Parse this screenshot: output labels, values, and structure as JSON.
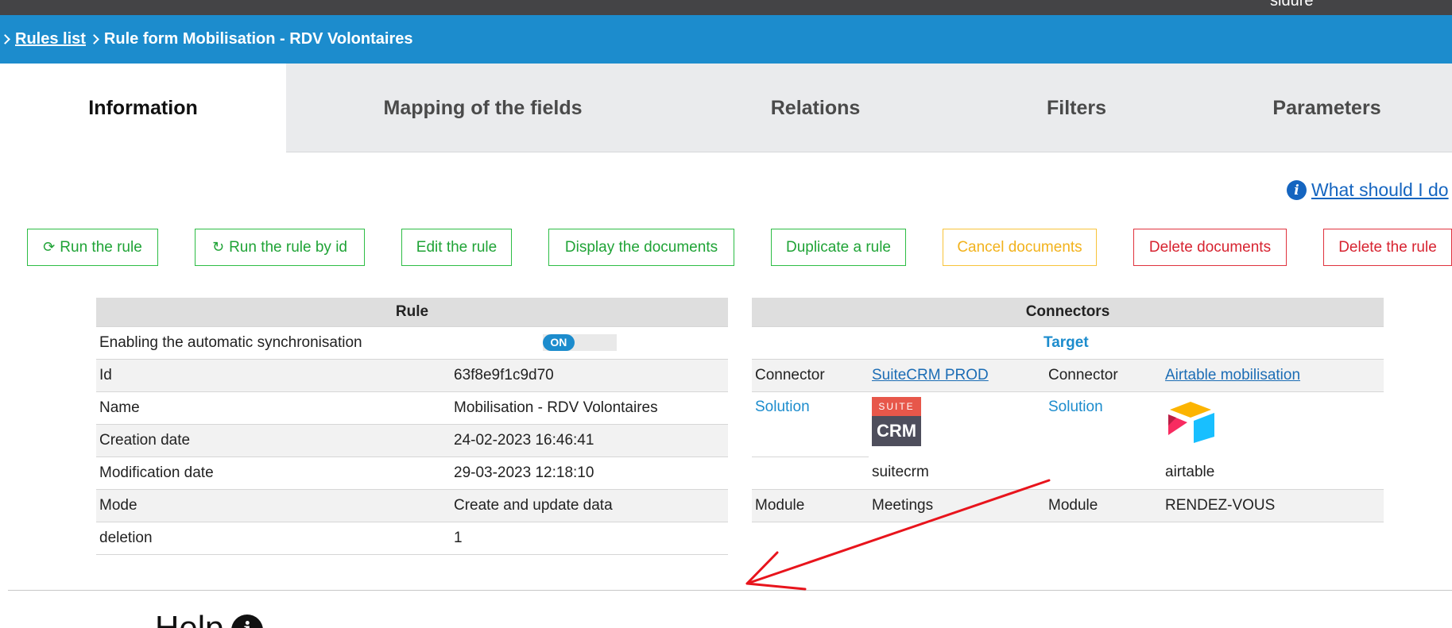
{
  "topbar": {
    "user_fragment": "sidure"
  },
  "breadcrumb": {
    "rules_list": "Rules list",
    "current": "Rule form Mobilisation - RDV Volontaires"
  },
  "tabs": [
    {
      "label": "Information",
      "active": true
    },
    {
      "label": "Mapping of the fields"
    },
    {
      "label": "Relations"
    },
    {
      "label": "Filters"
    },
    {
      "label": "Parameters"
    }
  ],
  "help_link": "What should I do",
  "buttons": {
    "run_rule": "Run the rule",
    "run_rule_by_id": "Run the rule by id",
    "edit_rule": "Edit the rule",
    "display_documents": "Display the documents",
    "duplicate_rule": "Duplicate a rule",
    "cancel_documents": "Cancel documents",
    "delete_documents": "Delete documents",
    "delete_rule": "Delete the rule"
  },
  "rule": {
    "header": "Rule",
    "sync_label": "Enabling the automatic synchronisation",
    "sync_toggle": "ON",
    "rows": [
      {
        "label": "Id",
        "value": "63f8e9f1c9d70"
      },
      {
        "label": "Name",
        "value": "Mobilisation - RDV Volontaires"
      },
      {
        "label": "Creation date",
        "value": "24-02-2023 16:46:41"
      },
      {
        "label": "Modification date",
        "value": "29-03-2023 12:18:10"
      },
      {
        "label": "Mode",
        "value": "Create and update data"
      },
      {
        "label": "deletion",
        "value": "1"
      }
    ]
  },
  "connectors": {
    "header": "Connectors",
    "target_label": "Target",
    "connector_label": "Connector",
    "solution_label": "Solution",
    "module_label": "Module",
    "source": {
      "connector": "SuiteCRM PROD",
      "solution": "suitecrm",
      "module": "Meetings",
      "logo_top": "SUITE",
      "logo_bottom": "CRM"
    },
    "target": {
      "connector": "Airtable mobilisation",
      "solution": "airtable",
      "module": "RENDEZ-VOUS"
    }
  },
  "help_section": {
    "title": "Help",
    "icon": "i"
  },
  "colors": {
    "header_blue": "#1c8ccd",
    "green": "#2dbd45",
    "yellow": "#f8c33a",
    "red": "#e0323e",
    "annotation_red": "#e8141c"
  }
}
